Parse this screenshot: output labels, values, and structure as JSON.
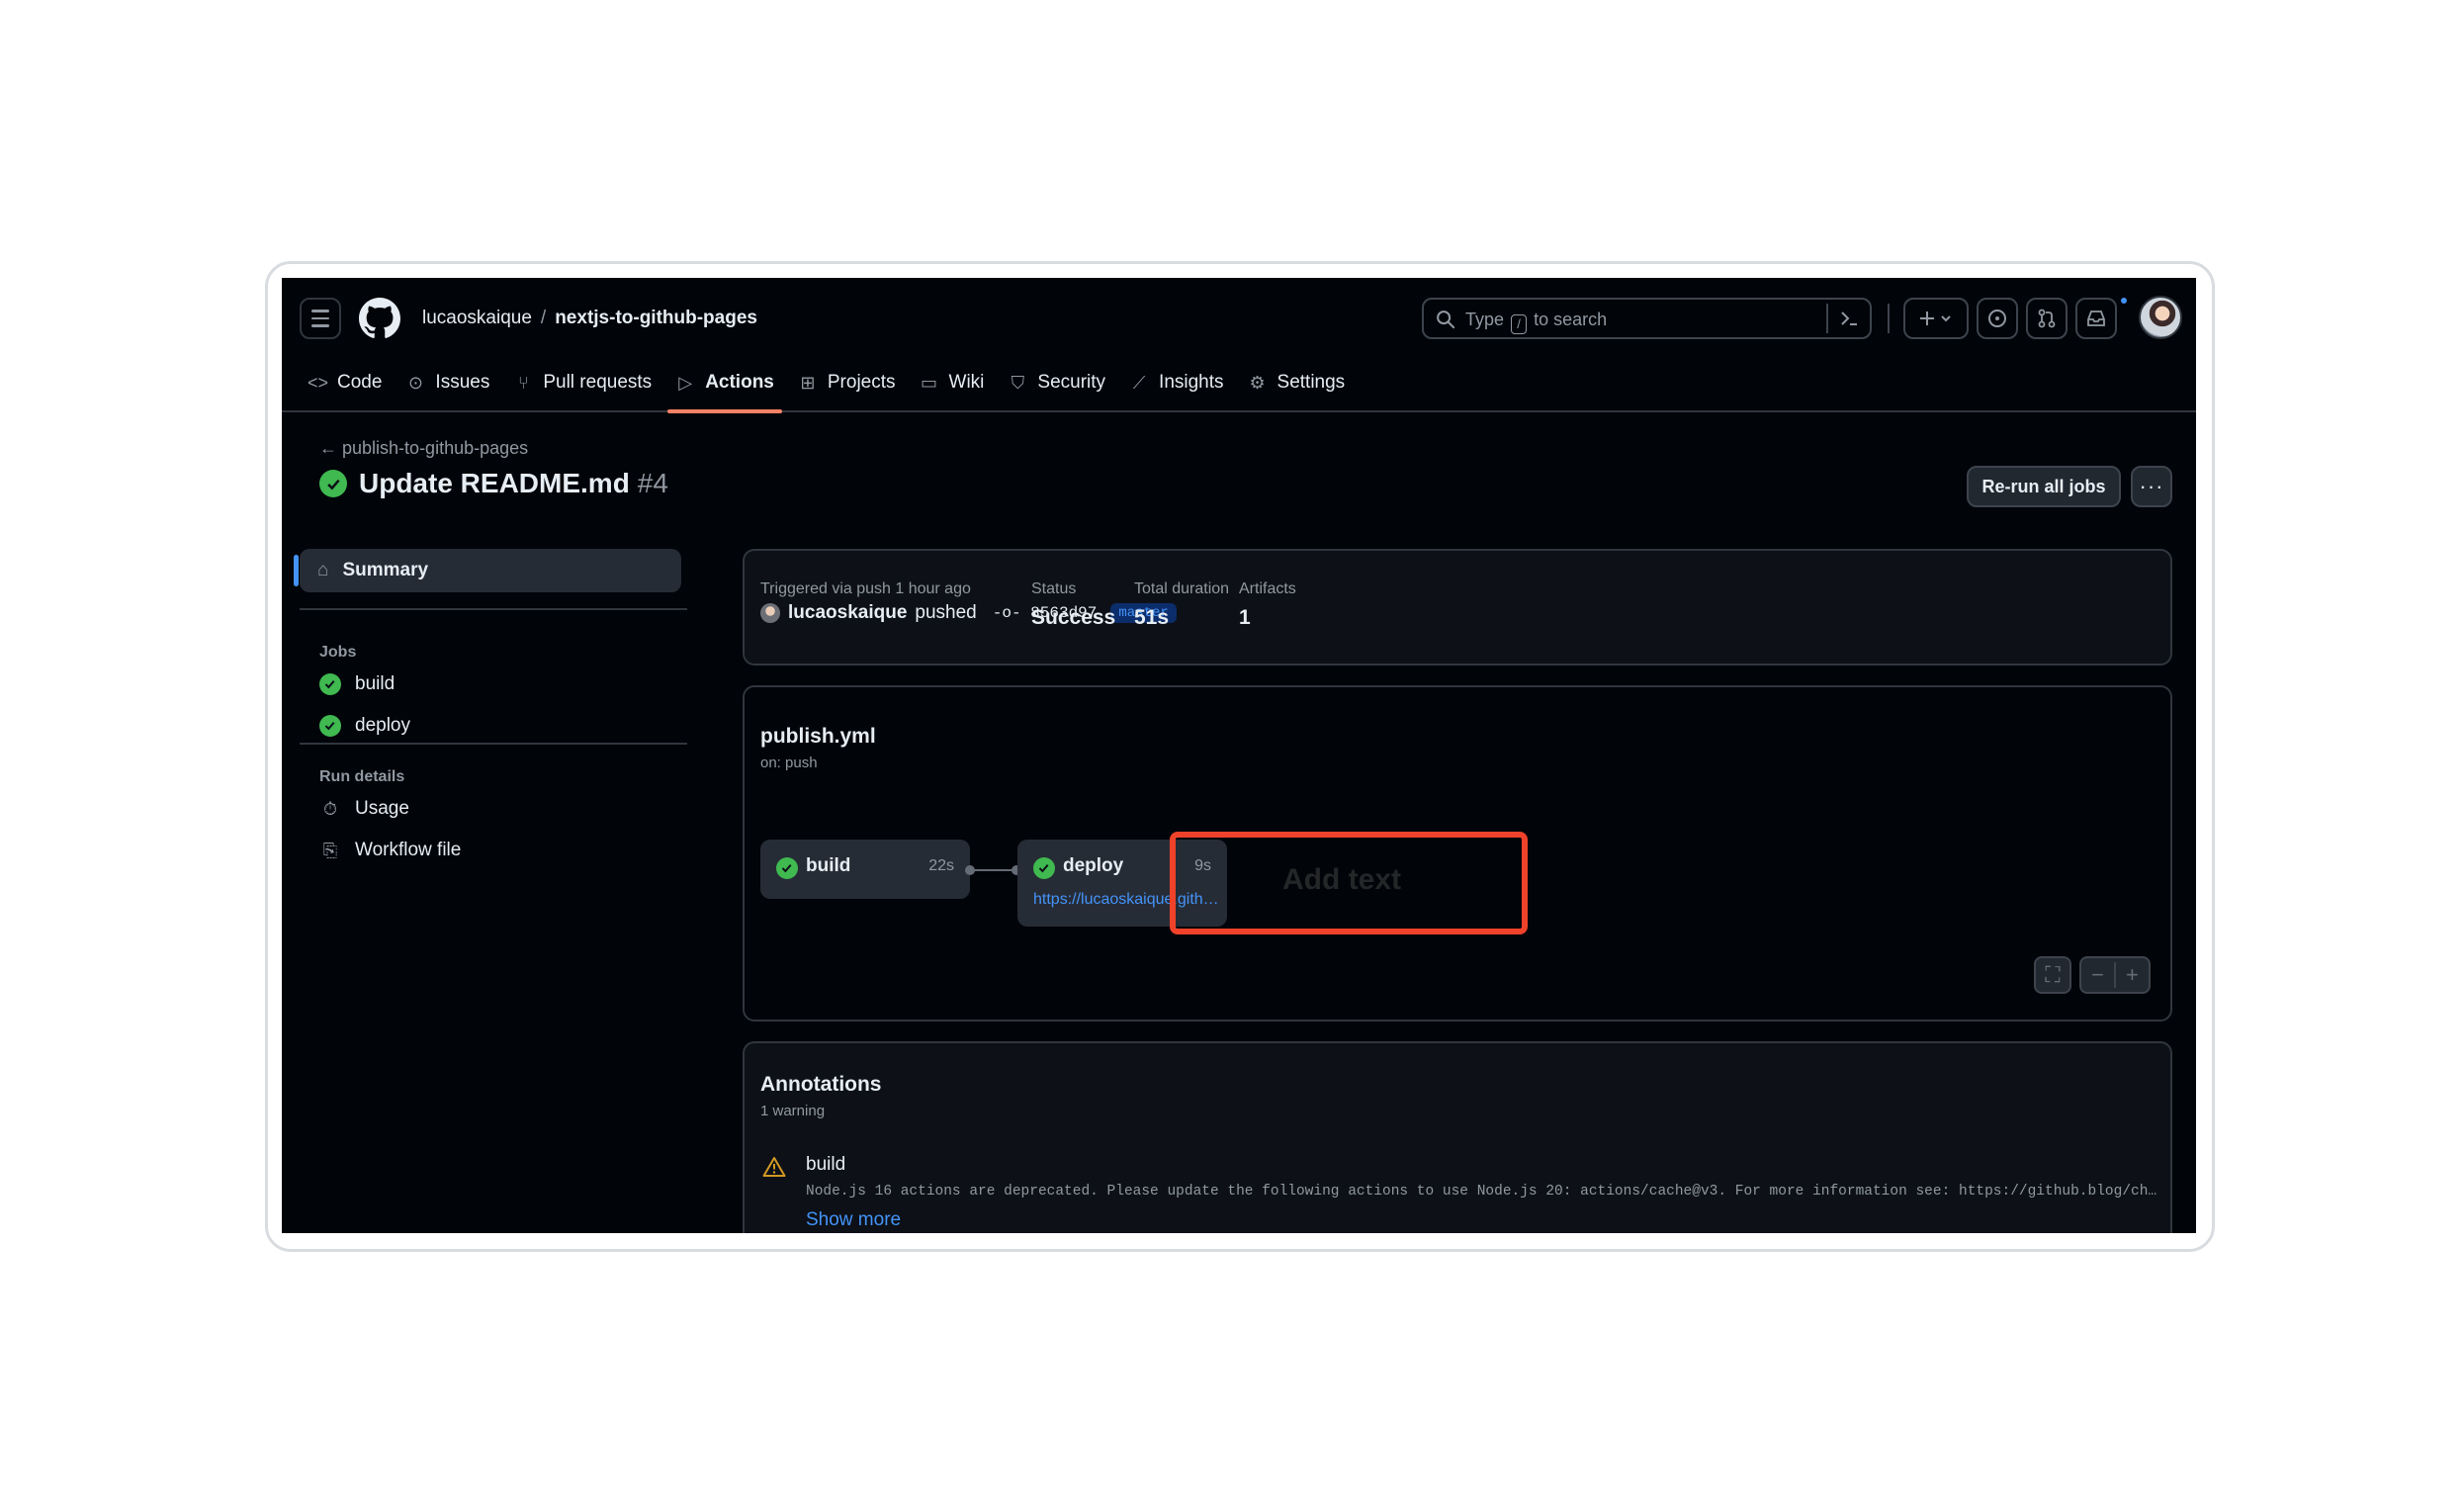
{
  "header": {
    "owner": "lucaoskaique",
    "separator": "/",
    "repo": "nextjs-to-github-pages",
    "search_before": "Type",
    "search_key": "/",
    "search_after": "to search"
  },
  "tabs": [
    {
      "label": "Code",
      "icon": "code-icon"
    },
    {
      "label": "Issues",
      "icon": "issue-icon"
    },
    {
      "label": "Pull requests",
      "icon": "pull-request-icon"
    },
    {
      "label": "Actions",
      "icon": "play-icon",
      "active": true
    },
    {
      "label": "Projects",
      "icon": "table-icon"
    },
    {
      "label": "Wiki",
      "icon": "book-icon"
    },
    {
      "label": "Security",
      "icon": "shield-icon"
    },
    {
      "label": "Insights",
      "icon": "graph-icon"
    },
    {
      "label": "Settings",
      "icon": "gear-icon"
    }
  ],
  "run": {
    "back_label": "publish-to-github-pages",
    "title": "Update README.md",
    "number": "#4",
    "rerun_label": "Re-run all jobs",
    "more_label": "···"
  },
  "sidebar": {
    "summary_label": "Summary",
    "jobs_heading": "Jobs",
    "jobs": [
      "build",
      "deploy"
    ],
    "details_heading": "Run details",
    "usage_label": "Usage",
    "workflow_file_label": "Workflow file"
  },
  "summary": {
    "triggered_label": "Triggered via push 1 hour ago",
    "actor": "lucaoskaique",
    "action": "pushed",
    "commit": "8563d97",
    "branch": "master",
    "status_label": "Status",
    "status_value": "Success",
    "duration_label": "Total duration",
    "duration_value": "51s",
    "artifacts_label": "Artifacts",
    "artifacts_value": "1"
  },
  "graph": {
    "workflow": "publish.yml",
    "trigger": "on: push",
    "jobs": [
      {
        "name": "build",
        "duration": "22s"
      },
      {
        "name": "deploy",
        "duration": "9s",
        "url": "https://lucaoskaique.github.io/nextjs-to-gi..."
      }
    ],
    "overlay_text": "Add text",
    "highlight_color": "#f0422b"
  },
  "annotations": {
    "title": "Annotations",
    "count": "1 warning",
    "job": "build",
    "message": "Node.js 16 actions are deprecated. Please update the following actions to use Node.js 20: actions/cache@v3. For more information see: https://github.blog/ch...",
    "show_more": "Show more"
  },
  "colors": {
    "success": "#3fb950",
    "accent": "#4493f8",
    "active_tab": "#f78166",
    "warning": "#d29922"
  }
}
